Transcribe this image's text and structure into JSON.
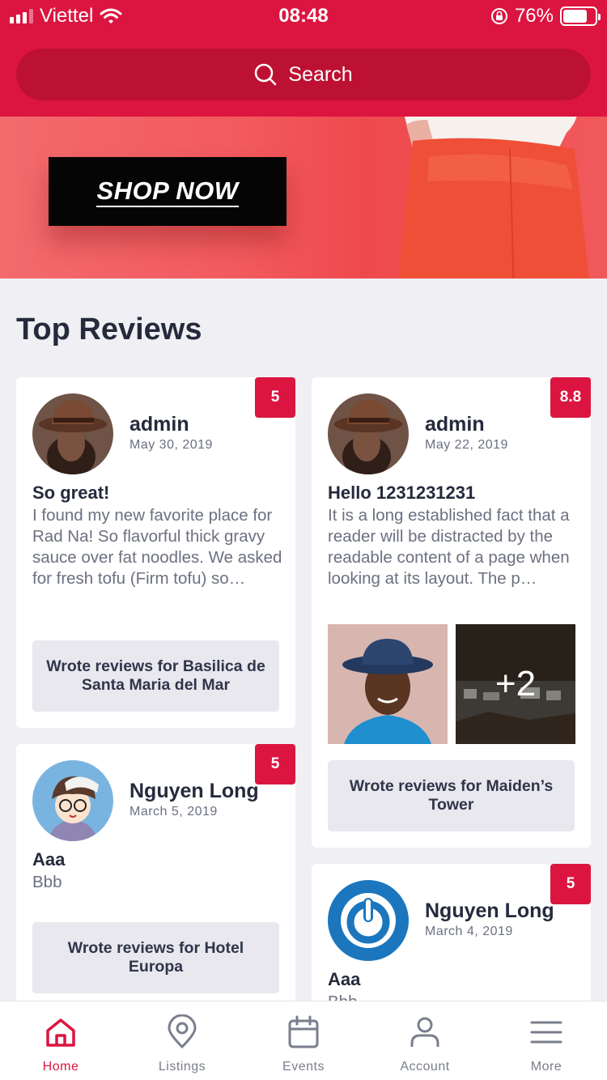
{
  "status_bar": {
    "carrier": "Viettel",
    "time": "08:48",
    "battery": "76%",
    "battery_level": 0.76
  },
  "search": {
    "label": "Search",
    "icon": "search-icon"
  },
  "banner": {
    "button_label": "SHOP NOW"
  },
  "section": {
    "title": "Top Reviews"
  },
  "reviews": [
    {
      "score": "5",
      "author": "admin",
      "date": "May 30, 2019",
      "title": "So great!",
      "text": "I found my new favorite place for Rad Na! So flavorful thick gravy sauce over fat noodles. We asked for fresh tofu (Firm tofu) so…",
      "wrote": "Wrote reviews for Basilica de Santa Maria del Mar"
    },
    {
      "score": "8.8",
      "author": "admin",
      "date": "May 22, 2019",
      "title": "Hello 1231231231",
      "text": "It is a long established fact that a reader will be distracted by the readable content of a page when looking at its layout. The p…",
      "more_photos": "+2",
      "wrote": "Wrote reviews for Maiden’s Tower"
    },
    {
      "score": "5",
      "author": "Nguyen Long",
      "date": "March 5, 2019",
      "title": "Aaa",
      "text": "Bbb",
      "wrote": "Wrote reviews for Hotel Europa"
    },
    {
      "score": "5",
      "author": "Nguyen Long",
      "date": "March 4, 2019",
      "title": "Aaa",
      "text": "Bbb"
    }
  ],
  "tabs": [
    {
      "label": "Home",
      "icon": "home-icon",
      "active": true
    },
    {
      "label": "Listings",
      "icon": "map-pin-icon"
    },
    {
      "label": "Events",
      "icon": "calendar-icon"
    },
    {
      "label": "Account",
      "icon": "user-icon"
    },
    {
      "label": "More",
      "icon": "menu-icon"
    }
  ],
  "colors": {
    "accent": "#dc1540",
    "search_bg": "#bd1133",
    "text_dark": "#252a3c",
    "text_muted": "#6c7080",
    "page_bg": "#f0f0f4"
  }
}
